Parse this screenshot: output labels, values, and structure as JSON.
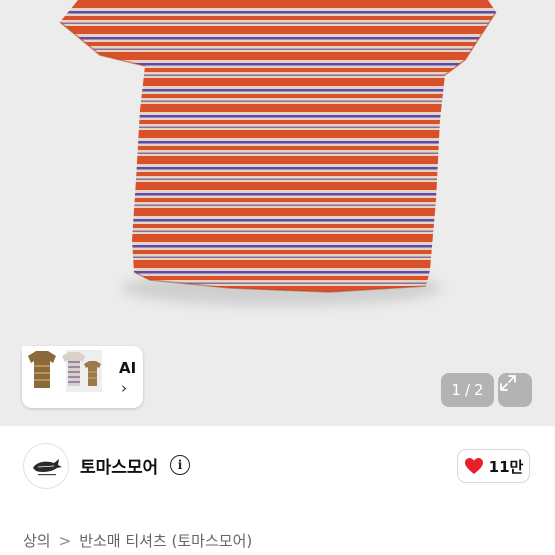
{
  "gallery": {
    "image_icon": "striped-tshirt-photo",
    "pager_current": "1",
    "pager_separator": "/",
    "pager_total": "2",
    "expand_icon": "expand-arrows-icon",
    "colors": {
      "orange": "#d9512a",
      "purple": "#5a4ab5",
      "beige": "#e6d4c2",
      "background": "#ececec"
    }
  },
  "ai_card": {
    "label": "AI",
    "chevron": "›",
    "thumb_icon": "tshirt-thumbnails"
  },
  "shop": {
    "name": "토마스모어",
    "logo_icon": "whale-logo",
    "info_icon_glyph": "i",
    "like_icon": "heart-icon",
    "like_color": "#e8202a",
    "like_count": "11만"
  },
  "breadcrumb": {
    "items": [
      "상의",
      "반소매 티셔츠 (토마스모어)"
    ],
    "separator": ">"
  }
}
